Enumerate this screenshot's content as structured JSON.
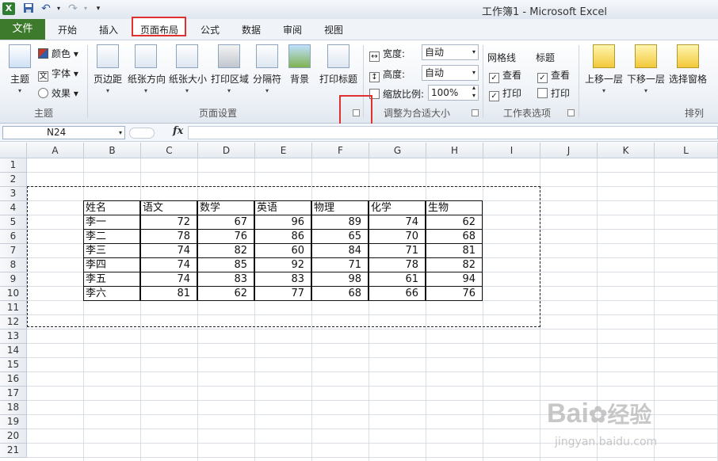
{
  "window": {
    "title": "工作簿1 - Microsoft Excel"
  },
  "quick_access": {
    "icons": [
      "excel-logo-icon",
      "save-icon",
      "undo-icon",
      "redo-icon",
      "customize-icon"
    ]
  },
  "tabs": {
    "file": "文件",
    "home": "开始",
    "insert": "插入",
    "page_layout": "页面布局",
    "formulas": "公式",
    "data": "数据",
    "review": "审阅",
    "view": "视图"
  },
  "ribbon": {
    "themes": {
      "theme": "主题",
      "colors": "颜色",
      "fonts": "字体",
      "effects": "效果",
      "group": "主题"
    },
    "page_setup": {
      "margins": "页边距",
      "orientation": "纸张方向",
      "size": "纸张大小",
      "print_area": "打印区域",
      "breaks": "分隔符",
      "background": "背景",
      "print_titles": "打印标题",
      "group": "页面设置"
    },
    "scale_to_fit": {
      "width_label": "宽度:",
      "width_value": "自动",
      "height_label": "高度:",
      "height_value": "自动",
      "scale_label": "缩放比例:",
      "scale_value": "100%",
      "group": "调整为合适大小"
    },
    "sheet_options": {
      "gridlines": "网格线",
      "headings": "标题",
      "view": "查看",
      "print": "打印",
      "group": "工作表选项",
      "gridlines_view": true,
      "gridlines_print": true,
      "headings_view": true,
      "headings_print": false
    },
    "arrange": {
      "bring_forward": "上移一层",
      "send_backward": "下移一层",
      "selection_pane": "选择窗格",
      "group": "排列"
    }
  },
  "formula_bar": {
    "name_box": "N24",
    "fx": "fx",
    "formula": ""
  },
  "sheet": {
    "columns": [
      "A",
      "B",
      "C",
      "D",
      "E",
      "F",
      "G",
      "H",
      "I",
      "J",
      "K",
      "L"
    ],
    "rows": [
      "1",
      "2",
      "3",
      "4",
      "5",
      "6",
      "7",
      "8",
      "9",
      "10",
      "11",
      "12",
      "13",
      "14",
      "15",
      "16",
      "17",
      "18",
      "19",
      "20",
      "21"
    ],
    "table_header": [
      "姓名",
      "语文",
      "数学",
      "英语",
      "物理",
      "化学",
      "生物"
    ],
    "table_rows": [
      [
        "李一",
        "72",
        "67",
        "96",
        "89",
        "74",
        "62"
      ],
      [
        "李二",
        "78",
        "76",
        "86",
        "65",
        "70",
        "68"
      ],
      [
        "李三",
        "74",
        "82",
        "60",
        "84",
        "71",
        "81"
      ],
      [
        "李四",
        "74",
        "85",
        "92",
        "71",
        "78",
        "82"
      ],
      [
        "李五",
        "74",
        "83",
        "83",
        "98",
        "61",
        "94"
      ],
      [
        "李六",
        "81",
        "62",
        "77",
        "68",
        "66",
        "76"
      ]
    ]
  },
  "watermark": {
    "brand": "Bai",
    "brand2": "经验",
    "url": "jingyan.baidu.com"
  },
  "colors": {
    "file_tab": "#3d7a2b",
    "highlight": "#e03030"
  }
}
